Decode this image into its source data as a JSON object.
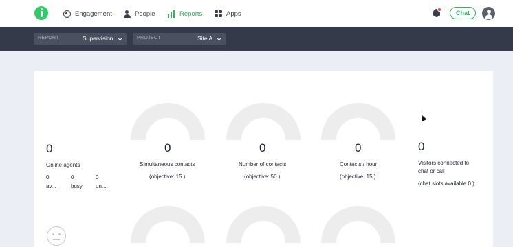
{
  "nav": {
    "items": [
      {
        "label": "Engagement",
        "icon": "target-icon"
      },
      {
        "label": "People",
        "icon": "person-icon"
      },
      {
        "label": "Reports",
        "icon": "bar-chart-icon",
        "active": true
      },
      {
        "label": "Apps",
        "icon": "grid-icon"
      }
    ],
    "chat_label": "Chat"
  },
  "filters": {
    "report": {
      "label": "REPORT",
      "value": "Supervision"
    },
    "project": {
      "label": "PROJECT",
      "value": "Site A"
    }
  },
  "agents": {
    "count": "0",
    "label": "Online agents",
    "stats": [
      {
        "value": "0",
        "label": "av..."
      },
      {
        "value": "0",
        "label": "busy"
      },
      {
        "value": "0",
        "label": "un..."
      }
    ]
  },
  "metrics": [
    {
      "value": "0",
      "label": "Simultaneous contacts",
      "objective": "(objective: 15 )"
    },
    {
      "value": "0",
      "label": "Number of contacts",
      "objective": "(objective: 50 )"
    },
    {
      "value": "0",
      "label": "Contacts / hour",
      "objective": "(objective: 15 )"
    }
  ],
  "visitors": {
    "value": "0",
    "label_line1": "Visitors connected to",
    "label_line2": "chat or call",
    "slots": "(chat slots available 0 )"
  },
  "colors": {
    "accent": "#2fb45e",
    "filterbar": "#343a4a",
    "gauge_track": "#ededed",
    "notification": "#e8473b"
  }
}
